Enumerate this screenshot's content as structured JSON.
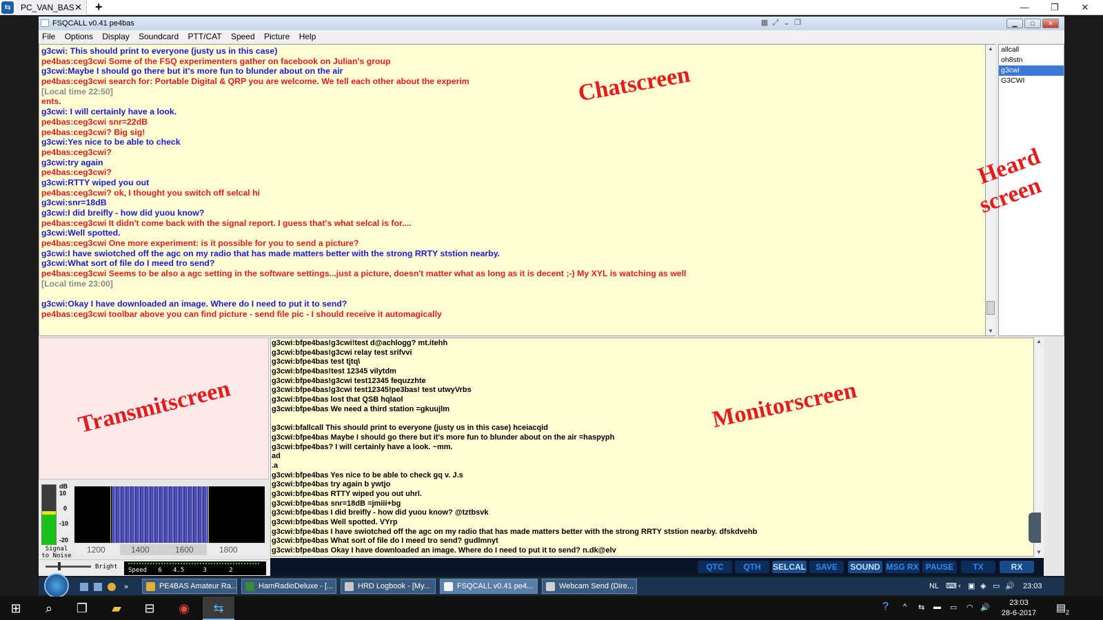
{
  "remote_tab": {
    "title": "PC_VAN_BAS",
    "close": "✕",
    "add": "+"
  },
  "window_controls": {
    "minimize": "—",
    "restore": "❐",
    "close": "✕"
  },
  "app": {
    "title": "FSQCALL v0.41  pe4bas",
    "menu": [
      "File",
      "Options",
      "Display",
      "Soundcard",
      "PTT/CAT",
      "Speed",
      "Picture",
      "Help"
    ]
  },
  "chat": {
    "lines": [
      {
        "text": "g3cwi: This should print to everyone (justy us in this case)",
        "who": "blue"
      },
      {
        "text": "pe4bas:ceg3cwi Some of the FSQ experimenters gather on facebook on Julian's group",
        "who": "red"
      },
      {
        "text": "g3cwi:Maybe I should go there but it's more fun to blunder about on the air",
        "who": "blue"
      },
      {
        "text": "pe4bas:ceg3cwi search for: Portable Digital & QRP you are welcome. We tell each other about the experim",
        "who": "red"
      },
      {
        "text": "[Local time 22:50]",
        "who": "gray"
      },
      {
        "text": "ents.",
        "who": "red"
      },
      {
        "text": "g3cwi: I will certainly have a look.",
        "who": "blue"
      },
      {
        "text": "pe4bas:ceg3cwi snr=22dB",
        "who": "red"
      },
      {
        "text": "pe4bas:ceg3cwi? Big sig!",
        "who": "red"
      },
      {
        "text": "g3cwi:Yes nice to be able to check",
        "who": "blue"
      },
      {
        "text": "pe4bas:ceg3cwi?",
        "who": "red"
      },
      {
        "text": "g3cwi:try again",
        "who": "blue"
      },
      {
        "text": "pe4bas:ceg3cwi?",
        "who": "red"
      },
      {
        "text": "g3cwi:RTTY wiped you out",
        "who": "blue"
      },
      {
        "text": "pe4bas:ceg3cwi? ok, I thought you switch off selcal hi",
        "who": "red"
      },
      {
        "text": "g3cwi:snr=18dB",
        "who": "blue"
      },
      {
        "text": "g3cwi:I did breifly - how did yuou know?",
        "who": "blue"
      },
      {
        "text": "pe4bas:ceg3cwi It didn't come back with the signal report. I guess that's what selcal is for....",
        "who": "red"
      },
      {
        "text": "g3cwi:Well spotted.",
        "who": "blue"
      },
      {
        "text": "pe4bas:ceg3cwi One more experiment: is it possible for you to send a picture?",
        "who": "red"
      },
      {
        "text": "g3cwi:I have swiotched off the agc on my radio that has made matters better with the strong RRTY ststion nearby.",
        "who": "blue"
      },
      {
        "text": "g3cwi:What sort of file do I meed tro send?",
        "who": "blue"
      },
      {
        "text": "pe4bas:ceg3cwi Seems to be also a agc setting in the software settings...just a picture, doesn't matter what as long as it is decent ;-) My XYL is watching as well",
        "who": "red"
      },
      {
        "text": "[Local time 23:00]",
        "who": "gray"
      },
      {
        "text": "",
        "who": "blue"
      },
      {
        "text": "g3cwi:Okay I have downloaded an image. Where do I need to put it to send?",
        "who": "blue"
      },
      {
        "text": "pe4bas:ceg3cwi toolbar above you can find picture - send file pic - I should receive it automagically",
        "who": "red"
      }
    ]
  },
  "heard": {
    "items": [
      "allcall",
      "oh8stn",
      "g3cwi",
      "G3CWI"
    ],
    "selected_index": 2
  },
  "monitor": {
    "lines": [
      "g3cwi:bfpe4bas!g3cwi!test    d@achlogg?    mt.itehh",
      "g3cwi:bfpe4bas!g3cwi relay test    srifvvi",
      "g3cwi:bfpe4bas test      tjtq\\",
      "g3cwi:bfpe4bas!test 12345    vilytdm",
      "g3cwi:bfpe4bas!g3cwi test12345    fequzzhte",
      "g3cwi:bfpe4bas!g3cwi test12345!pe3bas! test    utwyVrbs",
      "g3cwi:bfpe4bas lost that QSB    hqlaol",
      "g3cwi:bfpe4bas We need a third station    =gkuujlm",
      "",
      "g3cwi:bfallcall This should print to everyone (justy us in this case)    hceiacqid",
      "g3cwi:bfpe4bas Maybe I should go there but it's more fun to blunder about on the air    =haspyph",
      "g3cwi:bfpe4bas? I will certainly have a look.   ~mm.",
      "ad",
      ".a",
      "g3cwi:bfpe4bas Yes nice to be able to check    gq v. J.s",
      "g3cwi:bfpe4bas try again    b ywtjo",
      "g3cwi:bfpe4bas RTTY wiped you out    uhrl.",
      "g3cwi:bfpe4bas snr=18dB   =jmiii+bg",
      "g3cwi:bfpe4bas I did breifly - how did yuou know?   @tztbsvk",
      "g3cwi:bfpe4bas Well spotted.    VYrp",
      "g3cwi:bfpe4bas I have swiotched off the agc on my radio that has made matters better with the strong RRTY ststion nearby.    dfskdvehb",
      "g3cwi:bfpe4bas What sort of file do I meed tro send?    gudlmnyt",
      "g3cwi:bfpe4bas Okay I have downloaded an image. Where do I need to put it to send?    n.dk@elv"
    ]
  },
  "signal_meter": {
    "unit": "dB",
    "ticks": [
      "10",
      "0",
      "-10",
      "-20"
    ],
    "label": "Signal\nto Noise",
    "level_db": -3,
    "range_db": [
      -20,
      12
    ]
  },
  "waterfall": {
    "freq_labels": [
      "1200",
      "1400",
      "1600",
      "1800"
    ],
    "bright_label": "Bright",
    "speed_label": "Speed   6   4.5     3      2"
  },
  "buttons": [
    {
      "label": "QTC",
      "lit": false
    },
    {
      "label": "QTH",
      "lit": false
    },
    {
      "label": "SELCAL",
      "lit": true
    },
    {
      "label": "SAVE",
      "lit": false
    },
    {
      "label": "SOUND",
      "lit": true
    },
    {
      "label": "MSG RX",
      "lit": false
    },
    {
      "label": "PAUSE",
      "lit": false
    },
    {
      "label": "TX",
      "lit": false
    },
    {
      "label": "RX",
      "lit": true
    }
  ],
  "remote_taskbar": {
    "items": [
      "PE4BAS Amateur Ra...",
      "HamRadioDeluxe - [...",
      "HRD Logbook - [My...",
      "FSQCALL v0.41  pe4...",
      "Webcam Send (Dire..."
    ],
    "active_index": 3,
    "lang": "NL",
    "time": "23:03"
  },
  "host_taskbar": {
    "time": "23:03",
    "date": "28-6-2017",
    "notif_count": "2"
  },
  "annotations": {
    "chat": "Chatscreen",
    "heard_1": "Heard",
    "heard_2": "screen",
    "transmit": "Transmitscreen",
    "monitor": "Monitorscreen"
  },
  "colors": {
    "chat_blue": "#1a1ad8",
    "chat_red": "#e41c1c",
    "annotation_red": "#e41c1c",
    "chat_bg": "#fffdd4",
    "transmit_bg": "#fde8ea"
  }
}
